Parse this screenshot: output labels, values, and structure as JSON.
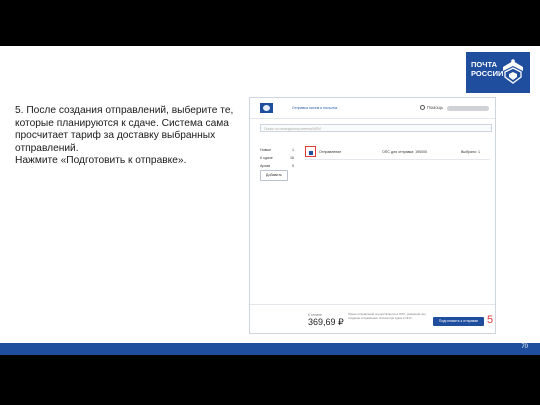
{
  "logo": {
    "text": "ПОЧТА РОССИИ"
  },
  "instruction": {
    "line1": "5. После создания отправлений, выберите те, которые планируются к сдаче. Система сама просчитает тариф за доставку выбранных отправлений.",
    "line2": "Нажмите «Подготовить к отправке»."
  },
  "screenshot": {
    "app_title": "Отправка писем и посылок",
    "help_label": "Помощь",
    "search_placeholder": "Поиск по номеру/получателю/ШПИ",
    "sidebar": [
      {
        "label": "Новые",
        "count": "1"
      },
      {
        "label": "К сдаче",
        "count": "16"
      },
      {
        "label": "Архив",
        "count": "0"
      }
    ],
    "add_button": "Добавить",
    "shipment_row": {
      "label": "Отправление",
      "office": "ОПС для отправки: 190000",
      "selected": "Выбрано: 1"
    },
    "total": {
      "label": "К оплате",
      "value": "369,69 ₽"
    },
    "info": "Прием отправлений осуществляется в ОПС, указанном при создании отправления. Оплата при сдаче в ОПС.",
    "submit_button": "Подготовить к отправке",
    "step_marker": "5"
  },
  "footer": {
    "page_number": "70"
  },
  "colors": {
    "brand_blue": "#1f4e9e",
    "highlight_red": "#e43a3a"
  }
}
